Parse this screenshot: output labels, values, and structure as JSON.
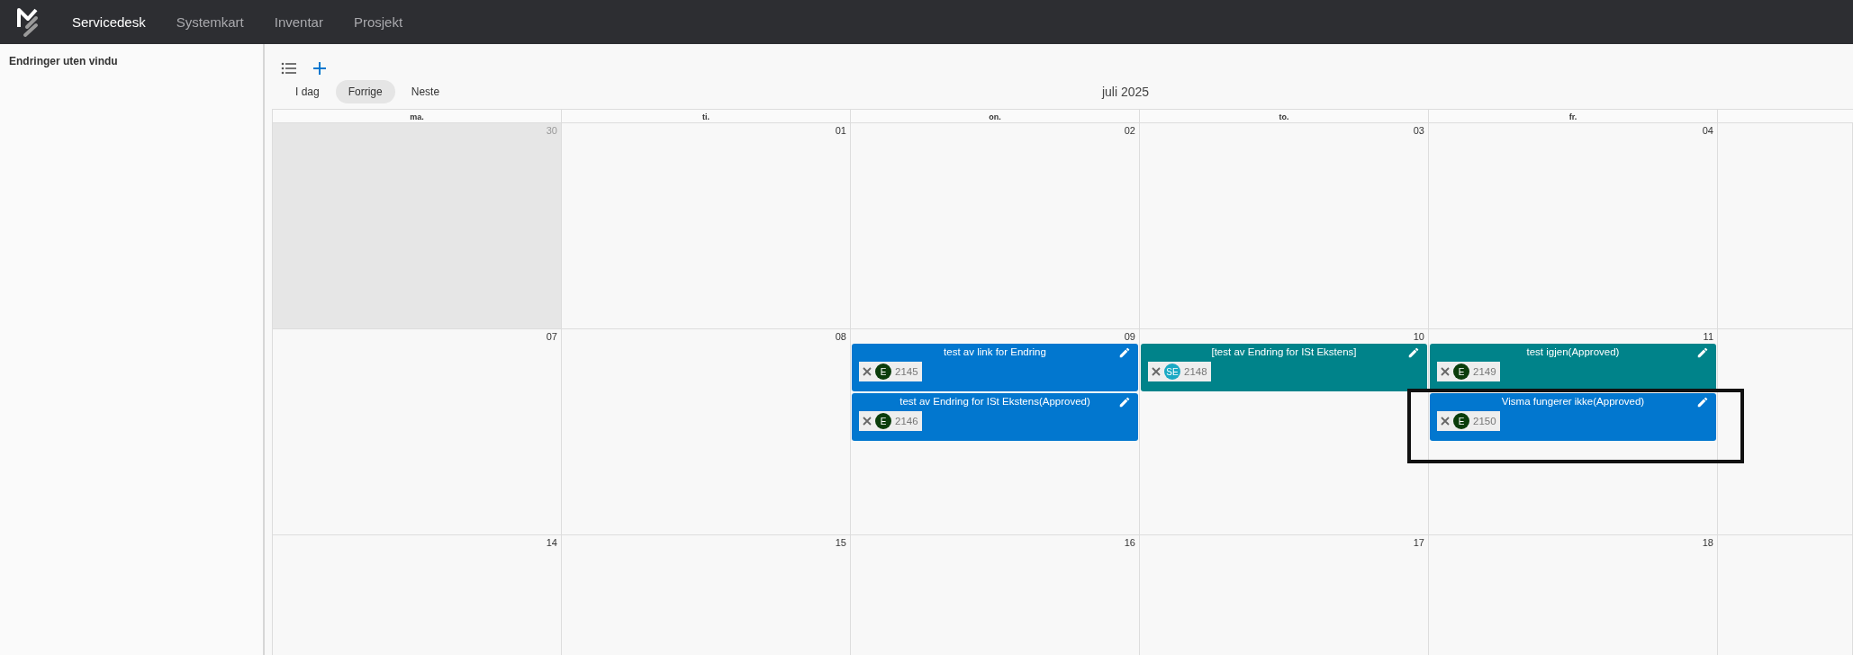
{
  "nav": {
    "items": [
      {
        "label": "Servicedesk",
        "selected": true
      },
      {
        "label": "Systemkart",
        "selected": false
      },
      {
        "label": "Inventar",
        "selected": false
      },
      {
        "label": "Prosjekt",
        "selected": false
      }
    ]
  },
  "sidebar": {
    "title": "Endringer uten vindu"
  },
  "toolbar": {
    "buttons": [
      {
        "label": "I dag",
        "selected": false
      },
      {
        "label": "Forrige",
        "selected": true
      },
      {
        "label": "Neste",
        "selected": false
      }
    ],
    "month": "juli 2025"
  },
  "calendar": {
    "weekdays": [
      "ma.",
      "ti.",
      "on.",
      "to.",
      "fr."
    ],
    "weeks": [
      {
        "days": [
          {
            "date": "30",
            "outside": true
          },
          {
            "date": "01",
            "outside": false
          },
          {
            "date": "02",
            "outside": false
          },
          {
            "date": "03",
            "outside": false
          },
          {
            "date": "04",
            "outside": false
          }
        ]
      },
      {
        "days": [
          {
            "date": "07",
            "outside": false
          },
          {
            "date": "08",
            "outside": false
          },
          {
            "date": "09",
            "outside": false,
            "events": [
              {
                "title": "test av link for Endring",
                "color": "#0277cf",
                "avatar": {
                  "initials": "E",
                  "color": "#0b3d0b"
                },
                "number": "2145",
                "highlighted": false
              },
              {
                "title": "test av Endring for ISt Ekstens(Approved)",
                "color": "#0277cf",
                "avatar": {
                  "initials": "E",
                  "color": "#0b3d0b"
                },
                "number": "2146",
                "highlighted": false
              }
            ]
          },
          {
            "date": "10",
            "outside": false,
            "events": [
              {
                "title": "[test av Endring for ISt Ekstens]",
                "color": "#00838a",
                "avatar": {
                  "initials": "SE",
                  "color": "#1aa9c4"
                },
                "number": "2148",
                "highlighted": false
              }
            ]
          },
          {
            "date": "11",
            "outside": false,
            "events": [
              {
                "title": "test igjen(Approved)",
                "color": "#00838a",
                "avatar": {
                  "initials": "E",
                  "color": "#0b3d0b"
                },
                "number": "2149",
                "highlighted": false
              },
              {
                "title": "Visma fungerer ikke(Approved)",
                "color": "#0277cf",
                "avatar": {
                  "initials": "E",
                  "color": "#0b3d0b"
                },
                "number": "2150",
                "highlighted": true
              }
            ]
          }
        ]
      },
      {
        "days": [
          {
            "date": "14",
            "outside": false
          },
          {
            "date": "15",
            "outside": false
          },
          {
            "date": "16",
            "outside": false
          },
          {
            "date": "17",
            "outside": false
          },
          {
            "date": "18",
            "outside": false
          }
        ]
      }
    ]
  }
}
